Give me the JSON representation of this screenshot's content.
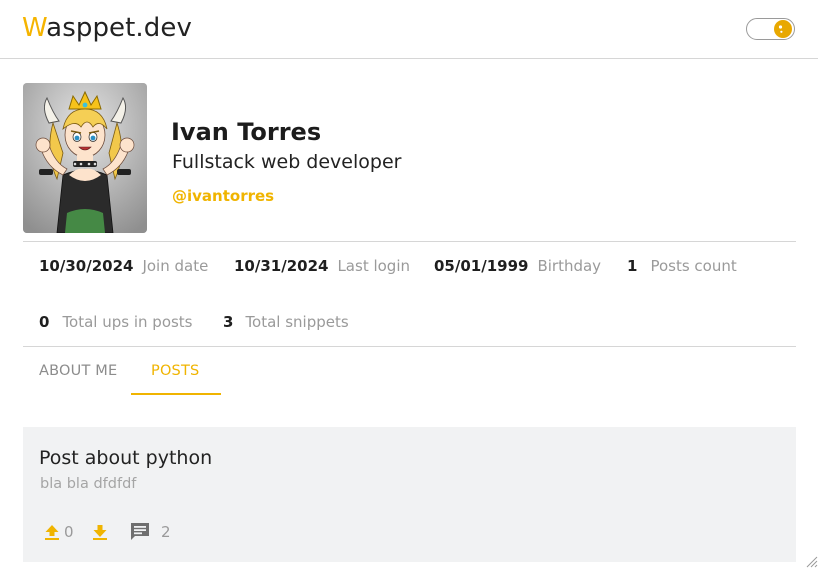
{
  "header": {
    "logo_first_letter": "W",
    "logo_rest": "asppet.dev"
  },
  "profile": {
    "name": "Ivan Torres",
    "title": "Fullstack web developer",
    "handle": "@ivantorres"
  },
  "stats": [
    {
      "value": "10/30/2024",
      "label": "Join date"
    },
    {
      "value": "10/31/2024",
      "label": "Last login"
    },
    {
      "value": "05/01/1999",
      "label": "Birthday"
    },
    {
      "value": "1",
      "label": "Posts count"
    },
    {
      "value": "0",
      "label": "Total ups in posts"
    },
    {
      "value": "3",
      "label": "Total snippets"
    }
  ],
  "tabs": [
    {
      "label": "ABOUT ME",
      "active": false
    },
    {
      "label": "POSTS",
      "active": true
    }
  ],
  "posts": [
    {
      "title": "Post about python",
      "body": "bla bla dfdfdf",
      "ups": "0",
      "comments": "2"
    }
  ],
  "colors": {
    "accent": "#f0b400",
    "muted_text": "#9a9a9a",
    "card_background": "#f1f2f3"
  },
  "icons": {
    "theme": "sun-moon-icon",
    "upvote": "arrow-up-bar-icon",
    "downvote": "arrow-down-bar-icon",
    "comment": "comment-icon"
  }
}
